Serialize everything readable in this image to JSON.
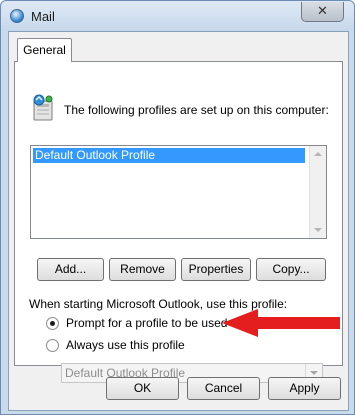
{
  "window": {
    "title": "Mail",
    "close_label": "✕"
  },
  "tabs": [
    {
      "label": "General"
    }
  ],
  "profiles_section": {
    "intro": "The following profiles are set up on this computer:",
    "profiles": [
      "Default Outlook Profile"
    ]
  },
  "profile_buttons": {
    "add": "Add...",
    "remove": "Remove",
    "properties": "Properties",
    "copy": "Copy..."
  },
  "startup": {
    "caption": "When starting Microsoft Outlook, use this profile:",
    "prompt_option": "Prompt for a profile to be used",
    "always_option": "Always use this profile",
    "selected_option": "prompt",
    "profile_select_value": "Default Outlook Profile"
  },
  "dialog_buttons": {
    "ok": "OK",
    "cancel": "Cancel",
    "apply": "Apply"
  },
  "colors": {
    "selection": "#3399ff",
    "annotation_arrow": "#e41e1e",
    "frame": "#c9daeb"
  }
}
